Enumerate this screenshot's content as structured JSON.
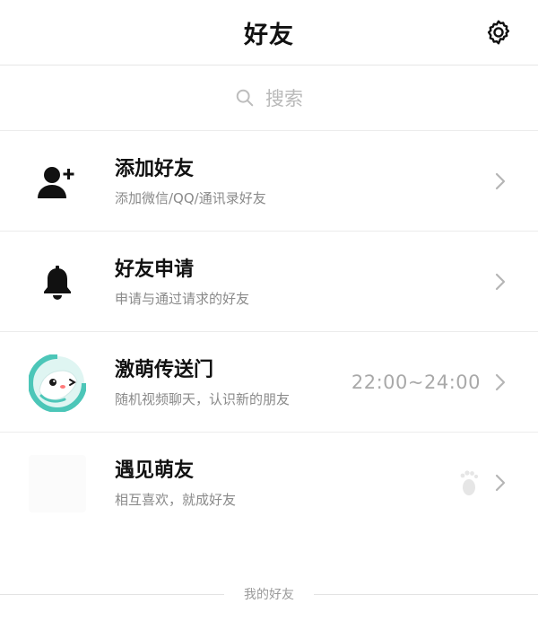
{
  "header": {
    "title": "好友",
    "settings_icon": "gear-icon"
  },
  "search": {
    "placeholder": "搜索",
    "icon": "search-icon"
  },
  "items": [
    {
      "title": "添加好友",
      "subtitle": "添加微信/QQ/通讯录好友",
      "icon": "add-user-icon",
      "right_text": ""
    },
    {
      "title": "好友申请",
      "subtitle": "申请与通过请求的好友",
      "icon": "bell-icon",
      "right_text": ""
    },
    {
      "title": "激萌传送门",
      "subtitle": "随机视频聊天，认识新的朋友",
      "icon": "mascot-avatar",
      "right_text": "22:00~24:00"
    },
    {
      "title": "遇见萌友",
      "subtitle": "相互喜欢，就成好友",
      "icon": "blank-avatar",
      "right_icon": "footprint-icon"
    }
  ],
  "section": {
    "my_friends_label": "我的好友"
  },
  "colors": {
    "accent_teal": "#4cc6b8",
    "text_primary": "#111111",
    "text_secondary": "#8a8a8a",
    "chevron": "#b5b5b5"
  }
}
